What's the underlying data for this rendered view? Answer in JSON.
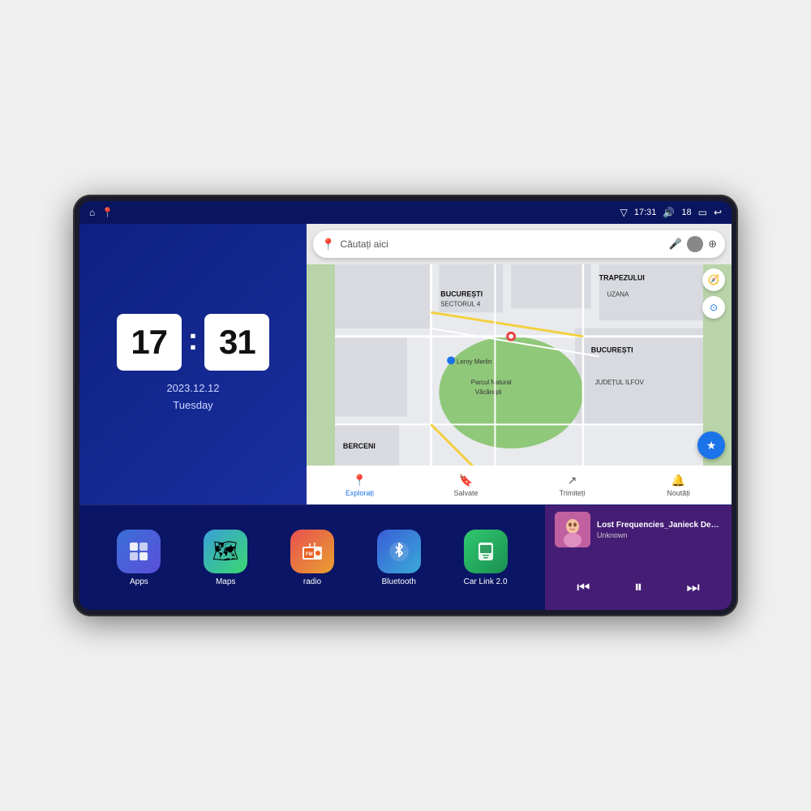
{
  "device": {
    "status_bar": {
      "signal_icon": "▽",
      "time": "17:31",
      "volume_icon": "🔊",
      "volume_level": "18",
      "battery_icon": "▭",
      "back_icon": "↩"
    },
    "clock": {
      "hours": "17",
      "minutes": "31",
      "date": "2023.12.12",
      "day": "Tuesday"
    },
    "map": {
      "search_placeholder": "Căutați aici",
      "bottom_nav": [
        {
          "icon": "📍",
          "label": "Explorați",
          "active": true
        },
        {
          "icon": "🔖",
          "label": "Salvate",
          "active": false
        },
        {
          "icon": "↗",
          "label": "Trimiteți",
          "active": false
        },
        {
          "icon": "🔔",
          "label": "Noutăți",
          "active": false
        }
      ],
      "labels": {
        "parcul": "Parcul Natural Văcărești",
        "leroy": "Leroy Merlin",
        "bucuresti": "BUCUREȘTI",
        "sectorul4": "BUCUREȘTI SECTORUL 4",
        "ilfov": "JUDEȚUL ILFOV",
        "berceni": "BERCENI",
        "trapezului": "TRAPEZULUI",
        "uzana": "UZANA"
      }
    },
    "apps": [
      {
        "id": "apps",
        "label": "Apps",
        "class": "app-apps",
        "icon": "⊞"
      },
      {
        "id": "maps",
        "label": "Maps",
        "class": "app-maps",
        "icon": "🗺"
      },
      {
        "id": "radio",
        "label": "radio",
        "class": "app-radio",
        "icon": "📻"
      },
      {
        "id": "bluetooth",
        "label": "Bluetooth",
        "class": "app-bt",
        "icon": "🔵"
      },
      {
        "id": "carlink",
        "label": "Car Link 2.0",
        "class": "app-carlink",
        "icon": "📱"
      }
    ],
    "music": {
      "title": "Lost Frequencies_Janieck Devy-...",
      "artist": "Unknown",
      "prev_icon": "⏮",
      "play_icon": "⏸",
      "next_icon": "⏭"
    }
  }
}
